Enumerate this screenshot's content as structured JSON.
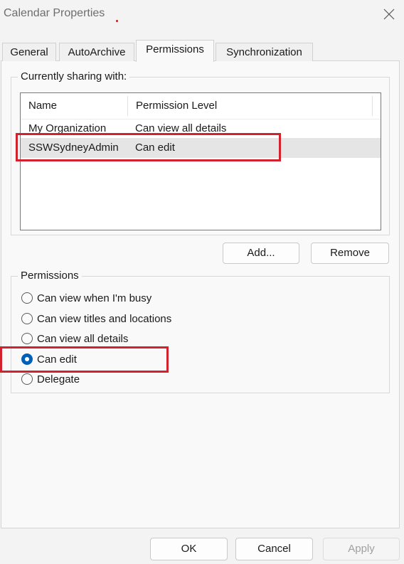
{
  "window": {
    "title": "Calendar Properties"
  },
  "tabs": [
    {
      "label": "General"
    },
    {
      "label": "AutoArchive"
    },
    {
      "label": "Permissions",
      "active": true
    },
    {
      "label": "Synchronization"
    }
  ],
  "sharing": {
    "legend": "Currently sharing with:",
    "columns": [
      "Name",
      "Permission Level"
    ],
    "rows": [
      {
        "name": "My Organization",
        "level": "Can view all details",
        "selected": false
      },
      {
        "name": "SSWSydneyAdmin",
        "level": "Can edit",
        "selected": true
      }
    ],
    "add_label": "Add...",
    "remove_label": "Remove"
  },
  "permissions": {
    "legend": "Permissions",
    "options": [
      {
        "label": "Can view when I'm busy",
        "checked": false
      },
      {
        "label": "Can view titles and locations",
        "checked": false
      },
      {
        "label": "Can view all details",
        "checked": false
      },
      {
        "label": "Can edit",
        "checked": true
      },
      {
        "label": "Delegate",
        "checked": false
      }
    ]
  },
  "footer": {
    "ok_label": "OK",
    "cancel_label": "Cancel",
    "apply_label": "Apply"
  },
  "colors": {
    "accent": "#005fb8",
    "highlight": "#d2222d"
  },
  "icons": {
    "close": "close-icon"
  }
}
